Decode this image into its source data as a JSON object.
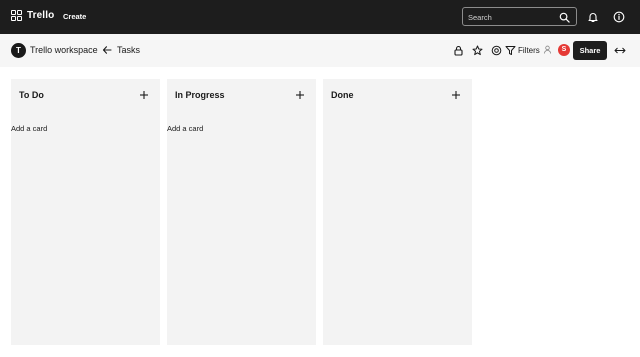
{
  "app": {
    "logo_text": "Trello",
    "create_label": "Create",
    "search_placeholder": "Search"
  },
  "header": {
    "workspace_initial": "T",
    "workspace_name": "Trello workspace",
    "board_title": "Tasks",
    "filters_label": "Filters",
    "user_badge": "S",
    "share_label": "Share"
  },
  "lists": [
    {
      "title": "To Do",
      "add_card_label": "Add a card"
    },
    {
      "title": "In Progress",
      "add_card_label": "Add a card"
    },
    {
      "title": "Done"
    }
  ],
  "icons": {
    "logo": "grid-icon",
    "search": "search-icon",
    "notifications": "bell-icon",
    "info": "info-icon",
    "back": "arrow-left-icon",
    "lock": "lock-icon",
    "star": "star-icon",
    "watch": "eye-icon",
    "filter": "filter-icon",
    "member": "person-icon",
    "expand": "expand-arrows-icon",
    "add": "plus-icon"
  },
  "colors": {
    "topbar": "#1d1d1d",
    "list_background": "#f3f3f3",
    "user_badge": "#e53935"
  }
}
